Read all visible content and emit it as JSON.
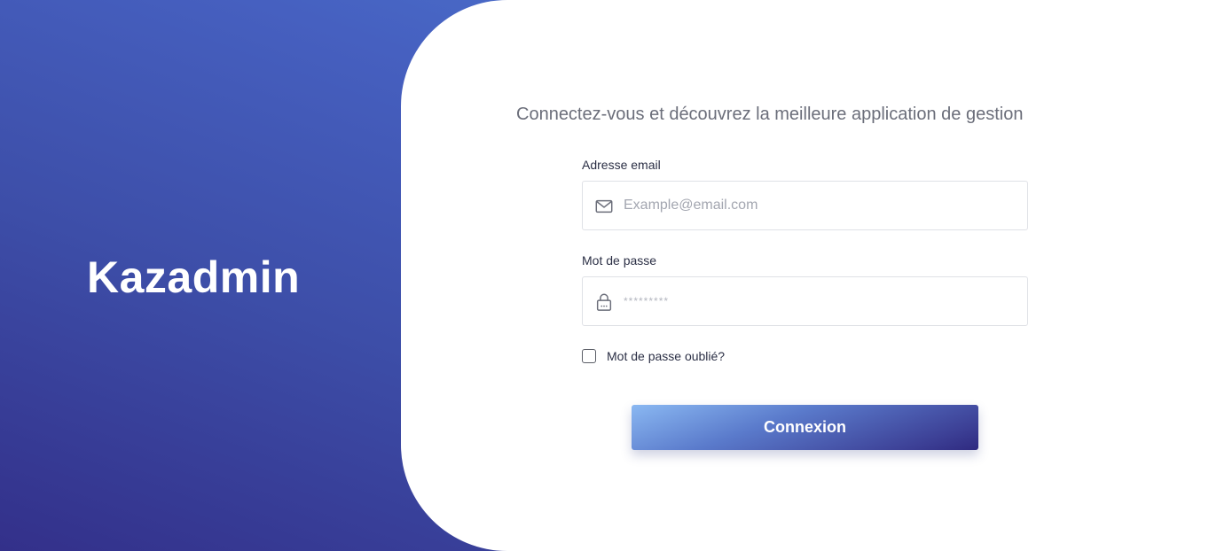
{
  "brand": {
    "name": "Kazadmin"
  },
  "login": {
    "tagline": "Connectez-vous et découvrez la meilleure application de gestion",
    "email": {
      "label": "Adresse email",
      "placeholder": "Example@email.com",
      "icon": "mail-icon"
    },
    "password": {
      "label": "Mot de passe",
      "placeholder": "*********",
      "icon": "lock-icon"
    },
    "forgot": {
      "label": "Mot de passe oublié?",
      "checked": false
    },
    "submit_label": "Connexion"
  },
  "colors": {
    "gradient_top": "#4e7fd6",
    "gradient_bottom": "#33308a",
    "panel": "#ffffff",
    "text": "#2b2f45",
    "muted": "#6b6e7a"
  }
}
